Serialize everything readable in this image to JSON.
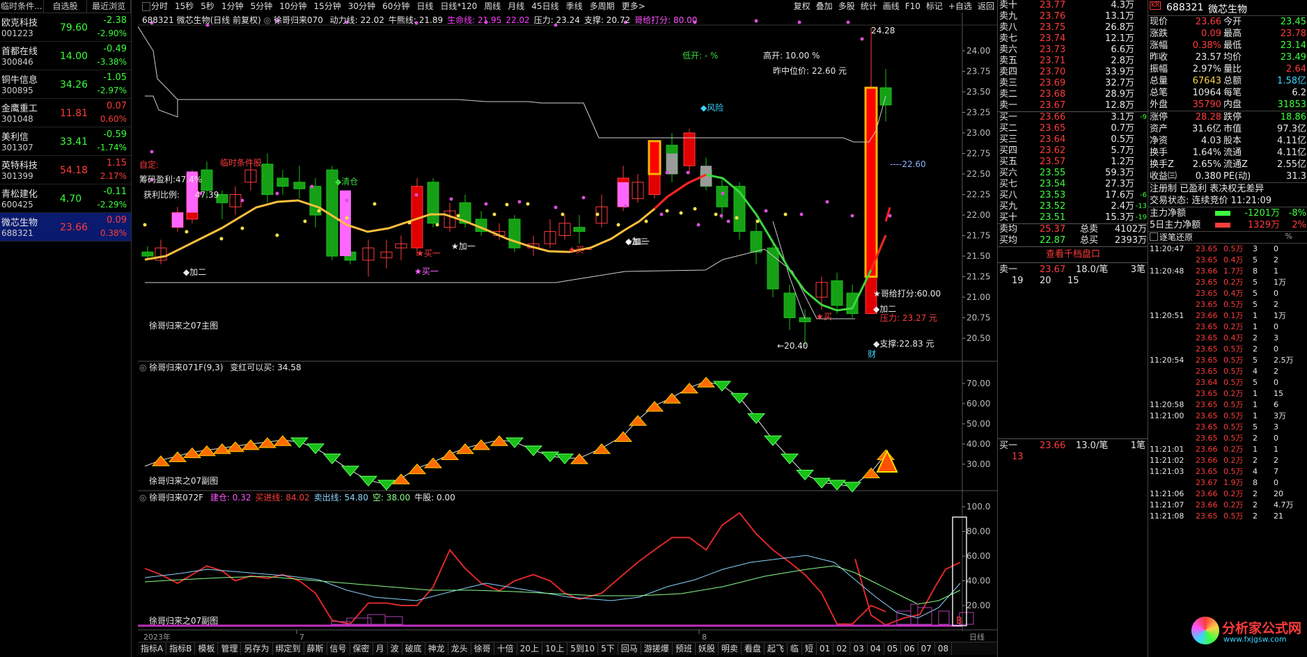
{
  "watchlist": {
    "tabs": [
      "临时条件...",
      "自选股",
      "最近浏览"
    ],
    "items": [
      {
        "name": "欧克科技",
        "code": "001223",
        "price": "79.60",
        "chg": "-2.38",
        "pct": "-2.90%",
        "dir": "dn"
      },
      {
        "name": "首都在线",
        "code": "300846",
        "price": "14.00",
        "chg": "-0.49",
        "pct": "-3.38%",
        "dir": "dn"
      },
      {
        "name": "铜牛信息",
        "code": "300895",
        "price": "34.26",
        "chg": "-1.05",
        "pct": "-2.97%",
        "dir": "dn"
      },
      {
        "name": "金鹰重工",
        "code": "301048",
        "price": "11.81",
        "chg": "0.07",
        "pct": "0.60%",
        "dir": "up"
      },
      {
        "name": "美利信",
        "code": "301307",
        "price": "33.41",
        "chg": "-0.59",
        "pct": "-1.74%",
        "dir": "dn"
      },
      {
        "name": "英特科技",
        "code": "301399",
        "price": "54.18",
        "chg": "1.15",
        "pct": "2.17%",
        "dir": "up"
      },
      {
        "name": "青松建化",
        "code": "600425",
        "price": "4.70",
        "chg": "-0.11",
        "pct": "-2.29%",
        "dir": "dn"
      },
      {
        "name": "微芯生物",
        "code": "688321",
        "price": "23.66",
        "chg": "0.09",
        "pct": "0.38%",
        "dir": "up"
      }
    ]
  },
  "menu": [
    "分时",
    "15秒",
    "5秒",
    "1分钟",
    "5分钟",
    "10分钟",
    "15分钟",
    "30分钟",
    "60分钟",
    "日线",
    "日线*120",
    "周线",
    "月线",
    "45日线",
    "季线",
    "多周期",
    "更多>"
  ],
  "menu_right": [
    "复权",
    "叠加",
    "多股",
    "统计",
    "画线",
    "F10",
    "标记",
    "+自选",
    "返回"
  ],
  "main_panel": {
    "title": "688321 微芯生物(日线 前复权)",
    "indicator": "徐哥归来070",
    "values": [
      {
        "label": "动力线: 22.02",
        "color": "#e8e8e8"
      },
      {
        "label": "牛熊线: 21.89",
        "color": "#e8e8e8"
      },
      {
        "label": "生命线: 21.95",
        "color": "#ff3cff"
      },
      {
        "label": "22.02",
        "color": "#ff3cff"
      },
      {
        "label": "压力: 23.24",
        "color": "#e8e8e8"
      },
      {
        "label": "支撑: 20.72",
        "color": "#e8e8e8"
      },
      {
        "label": "哥给打分: 80.00",
        "color": "#ff55ff"
      }
    ],
    "footer": "徐哥归来之07主图",
    "y_ticks": [
      "24.00",
      "23.75",
      "23.50",
      "23.25",
      "23.00",
      "22.75",
      "22.50",
      "22.25",
      "22.00",
      "21.75",
      "21.50",
      "21.25",
      "21.00",
      "20.75",
      "20.50"
    ],
    "annotations": {
      "low_open": "低开: - %",
      "high_open": "高开: 10.00 %",
      "prev_mid": "昨中位价: 22.60 元",
      "risk": "◆风险",
      "custom": "自定:",
      "chip_profit": "筹码盈利:47.4%",
      "profit_ratio": "获利比例:",
      "profit_val": "47.39",
      "temp_cond": "临时条件股",
      "clear": "◆清仓",
      "add1a": "◆加二",
      "add2a": "★加一",
      "buy1a": "★买一",
      "buy1b": "★买一",
      "add2b": "◆加二",
      "add2c": "★加一",
      "buy1c": "★买一",
      "high_val": "24.28",
      "price_mark": "----22.60",
      "score": "★哥给打分:60.00",
      "add2d": "◆加二",
      "press_line": "压力: 23.27 元",
      "buy_mark": "★买",
      "support_line": "◆支撑:22.83 元",
      "low_val": "←20.40",
      "cai": "财"
    }
  },
  "sub1": {
    "title": "徐哥归来071F(9,3)",
    "extra": "变红可以买: 34.58",
    "footer": "徐哥归来之07副图",
    "y_ticks": [
      "70.00",
      "60.00",
      "50.00",
      "40.00",
      "30.00"
    ]
  },
  "sub2": {
    "title": "徐哥归来072F",
    "values": [
      {
        "label": "建仓: 0.32",
        "color": "#ff55ff"
      },
      {
        "label": "买进线: 84.02",
        "color": "#ff3c3c"
      },
      {
        "label": "卖出线: 54.80",
        "color": "#8ad4ff"
      },
      {
        "label": "空: 38.00",
        "color": "#8aff8a"
      },
      {
        "label": "牛股: 0.00",
        "color": "#e8e8e8"
      }
    ],
    "footer": "徐哥归来之07副图",
    "y_ticks": [
      "100.0",
      "80.00",
      "60.00",
      "40.00",
      "20.00"
    ],
    "b_label": "B"
  },
  "time_axis": {
    "year": "2023年",
    "m7": "7",
    "m8": "8",
    "day": "日线"
  },
  "bottom_tabs": [
    "指标A",
    "指标B",
    "模板",
    "管理",
    "另存为",
    "绑定到",
    "薛斯",
    "信号",
    "保密",
    "月",
    "波",
    "破底",
    "神龙",
    "龙头",
    "徐哥",
    "十倍",
    "20上",
    "10上",
    "5到10",
    "5下",
    "回马",
    "游搓爆",
    "预班",
    "妖股",
    "明卖",
    "看盘",
    "起飞",
    "临",
    "短",
    "01",
    "02",
    "03",
    "04",
    "05",
    "06",
    "07",
    "08"
  ],
  "orderbook": {
    "asks": [
      {
        "label": "卖十",
        "price": "23.77",
        "vol": "4.3万"
      },
      {
        "label": "卖九",
        "price": "23.76",
        "vol": "13.1万"
      },
      {
        "label": "卖八",
        "price": "23.75",
        "vol": "26.8万"
      },
      {
        "label": "卖七",
        "price": "23.74",
        "vol": "12.1万"
      },
      {
        "label": "卖六",
        "price": "23.73",
        "vol": "6.6万"
      },
      {
        "label": "卖五",
        "price": "23.71",
        "vol": "2.8万"
      },
      {
        "label": "卖四",
        "price": "23.70",
        "vol": "33.9万"
      },
      {
        "label": "卖三",
        "price": "23.69",
        "vol": "32.7万"
      },
      {
        "label": "卖二",
        "price": "23.68",
        "vol": "28.9万"
      },
      {
        "label": "卖一",
        "price": "23.67",
        "vol": "12.8万"
      }
    ],
    "bids": [
      {
        "label": "买一",
        "price": "23.66",
        "vol": "3.1万",
        "chg": "-9"
      },
      {
        "label": "买二",
        "price": "23.65",
        "vol": "0.7万",
        "chg": ""
      },
      {
        "label": "买三",
        "price": "23.64",
        "vol": "0.5万",
        "chg": ""
      },
      {
        "label": "买四",
        "price": "23.62",
        "vol": "5.7万",
        "chg": ""
      },
      {
        "label": "买五",
        "price": "23.57",
        "vol": "1.2万",
        "chg": ""
      },
      {
        "label": "买六",
        "price": "23.55",
        "vol": "59.3万",
        "chg": ""
      },
      {
        "label": "买七",
        "price": "23.54",
        "vol": "27.3万",
        "chg": ""
      },
      {
        "label": "买八",
        "price": "23.53",
        "vol": "17.6万",
        "chg": "-6"
      },
      {
        "label": "买九",
        "price": "23.52",
        "vol": "2.4万",
        "chg": "-13"
      },
      {
        "label": "买十",
        "price": "23.51",
        "vol": "15.3万",
        "chg": "-19"
      }
    ],
    "avg_ask": {
      "label": "卖均",
      "price": "25.37",
      "tlabel": "总卖",
      "vol": "4102万"
    },
    "avg_bid": {
      "label": "买均",
      "price": "22.87",
      "tlabel": "总买",
      "vol": "2393万"
    },
    "depth_link": "查看千档盘口",
    "sell1_line": {
      "label": "卖一",
      "price": "23.67",
      "vol": "18.0/笔",
      "cnt": "3笔"
    },
    "sell1_orders": [
      "19",
      "20",
      "15"
    ],
    "buy1_line": {
      "label": "买一",
      "price": "23.66",
      "vol": "13.0/笔",
      "cnt": "1笔"
    },
    "buy1_orders": [
      "13"
    ]
  },
  "quote": {
    "code": "688321",
    "name": "微芯生物",
    "badge": "KR",
    "rows": [
      {
        "l1": "现价",
        "v1": "23.66",
        "c1": "up",
        "l2": "今开",
        "v2": "23.45",
        "c2": "dn"
      },
      {
        "l1": "涨跌",
        "v1": "0.09",
        "c1": "up",
        "l2": "最高",
        "v2": "23.78",
        "c2": "up"
      },
      {
        "l1": "涨幅",
        "v1": "0.38%",
        "c1": "up",
        "l2": "最低",
        "v2": "23.14",
        "c2": "dn"
      },
      {
        "l1": "昨收",
        "v1": "23.57",
        "c1": "wh",
        "l2": "均价",
        "v2": "23.49",
        "c2": "dn"
      },
      {
        "l1": "振幅",
        "v1": "2.97%",
        "c1": "wh",
        "l2": "量比",
        "v2": "2.64",
        "c2": "up"
      },
      {
        "l1": "总量",
        "v1": "67643",
        "c1": "yl",
        "l2": "总额",
        "v2": "1.58亿",
        "c2": "cy"
      },
      {
        "l1": "总笔",
        "v1": "10964",
        "c1": "wh",
        "l2": "每笔",
        "v2": "6.2",
        "c2": "wh"
      },
      {
        "l1": "外盘",
        "v1": "35790",
        "c1": "up",
        "l2": "内盘",
        "v2": "31853",
        "c2": "dn"
      }
    ],
    "rows2": [
      {
        "l1": "涨停",
        "v1": "28.28",
        "c1": "up",
        "l2": "跌停",
        "v2": "18.86",
        "c2": "dn"
      },
      {
        "l1": "资产",
        "v1": "31.6亿",
        "c1": "wh",
        "l2": "市值",
        "v2": "97.3亿",
        "c2": "wh"
      },
      {
        "l1": "净资",
        "v1": "4.03",
        "c1": "wh",
        "l2": "股本",
        "v2": "4.11亿",
        "c2": "wh"
      },
      {
        "l1": "换手",
        "v1": "1.64%",
        "c1": "wh",
        "l2": "流通",
        "v2": "4.11亿",
        "c2": "wh"
      },
      {
        "l1": "换手Z",
        "v1": "2.65%",
        "c1": "wh",
        "l2": "流通Z",
        "v2": "2.55亿",
        "c2": "wh"
      },
      {
        "l1": "收益㈢",
        "v1": "0.380",
        "c1": "wh",
        "l2": "PE(动)",
        "v2": "31.3",
        "c2": "wh"
      }
    ],
    "reg": "注册制 已盈利 表决权无差异",
    "trade_state": "交易状态: 连续竞价 11:21:09",
    "main_net": {
      "label": "主力净额",
      "val": "-1201万",
      "pct": "-8%"
    },
    "main_net5": {
      "label": "5日主力净额",
      "val": "1329万",
      "pct": "2%"
    },
    "ticks_title": "逐笔还原"
  },
  "ticks_col1": [
    {
      "t": "11:20:47",
      "p": "23.65",
      "v": "0.5万",
      "n": "3"
    },
    {
      "t": "",
      "p": "23.65",
      "v": "0.4万",
      "n": "5"
    },
    {
      "t": "11:20:48",
      "p": "23.66",
      "v": "1.7万",
      "n": "8"
    },
    {
      "t": "",
      "p": "23.65",
      "v": "0.2万",
      "n": "5"
    },
    {
      "t": "",
      "p": "23.65",
      "v": "0.4万",
      "n": "5"
    },
    {
      "t": "",
      "p": "23.65",
      "v": "0.5万",
      "n": "5"
    },
    {
      "t": "11:20:51",
      "p": "23.66",
      "v": "0.1万",
      "n": "1"
    },
    {
      "t": "",
      "p": "23.65",
      "v": "0.2万",
      "n": "1"
    },
    {
      "t": "",
      "p": "23.65",
      "v": "0.4万",
      "n": "2"
    },
    {
      "t": "",
      "p": "23.65",
      "v": "0.5万",
      "n": "2"
    },
    {
      "t": "11:20:54",
      "p": "23.65",
      "v": "0.5万",
      "n": "5"
    },
    {
      "t": "",
      "p": "23.65",
      "v": "0.5万",
      "n": "4"
    },
    {
      "t": "",
      "p": "23.64",
      "v": "0.5万",
      "n": "5"
    },
    {
      "t": "",
      "p": "23.65",
      "v": "0.2万",
      "n": "1"
    },
    {
      "t": "11:20:58",
      "p": "23.65",
      "v": "0.5万",
      "n": "1"
    },
    {
      "t": "11:21:00",
      "p": "23.65",
      "v": "0.5万",
      "n": "1"
    },
    {
      "t": "",
      "p": "23.65",
      "v": "0.5万",
      "n": "5"
    },
    {
      "t": "",
      "p": "23.65",
      "v": "0.5万",
      "n": "2"
    },
    {
      "t": "11:21:01",
      "p": "23.66",
      "v": "0.2万",
      "n": "1"
    },
    {
      "t": "11:21:02",
      "p": "23.66",
      "v": "0.2万",
      "n": "2"
    },
    {
      "t": "11:21:03",
      "p": "23.65",
      "v": "0.5万",
      "n": "4"
    },
    {
      "t": "",
      "p": "23.67",
      "v": "1.9万",
      "n": "8"
    },
    {
      "t": "11:21:06",
      "p": "23.66",
      "v": "0.2万",
      "n": "2"
    },
    {
      "t": "11:21:07",
      "p": "23.66",
      "v": "0.2万",
      "n": "2"
    },
    {
      "t": "11:21:08",
      "p": "23.65",
      "v": "0.5万",
      "n": "2"
    }
  ],
  "ticks_col2": [
    "0",
    "2",
    "1",
    "1万",
    "0",
    "2",
    "1万",
    "0",
    "3",
    "0",
    "2.5万",
    "2",
    "0",
    "15",
    "6",
    "3万",
    "3",
    "0",
    "1",
    "2",
    "7",
    "0",
    "20",
    "4.7万",
    "21"
  ],
  "brand": {
    "site": "分析家公式网",
    "url": "www.fxjgsw.com"
  }
}
